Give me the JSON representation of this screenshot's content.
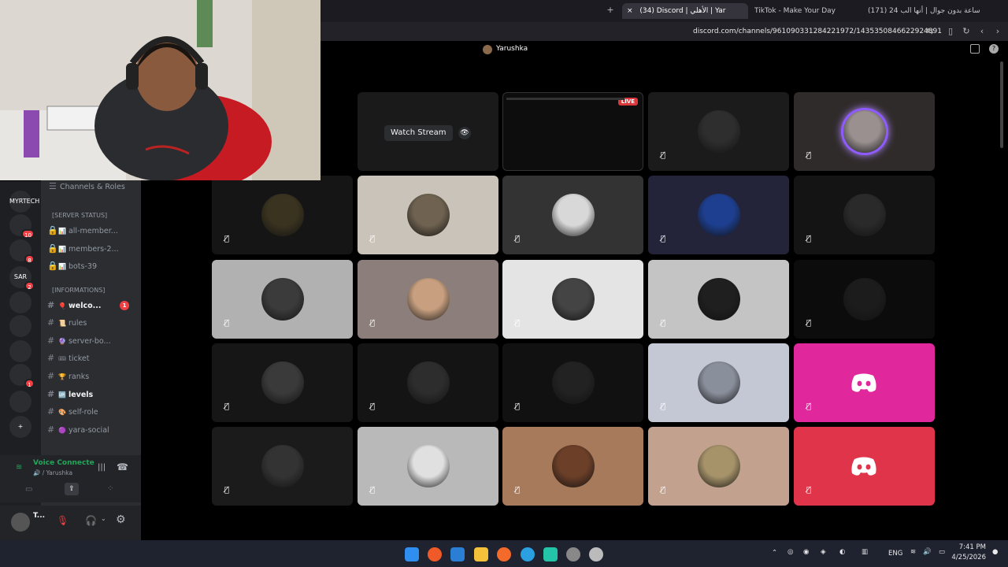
{
  "browser": {
    "tabs": [
      {
        "label": "(34) Discord | الأهلي | Yar",
        "active": true
      },
      {
        "label": "TikTok - Make Your Day",
        "active": false
      },
      {
        "label": "(171) 24 ساعة بدون جوال | أنها الب",
        "active": false
      }
    ],
    "new_tab": "+",
    "close_tab": "×",
    "url": "discord.com/channels/961090331284221972/1435350846622924891"
  },
  "call": {
    "header_user": "Yarushka",
    "watch_stream_label": "Watch Stream",
    "live_badge": "LIVE"
  },
  "servers": [
    {
      "label": "MYRTECH",
      "badge": ""
    },
    {
      "label": "",
      "badge": "10"
    },
    {
      "label": "",
      "badge": "8"
    },
    {
      "label": "SAR",
      "badge": "2"
    },
    {
      "label": "",
      "badge": ""
    },
    {
      "label": "",
      "badge": ""
    },
    {
      "label": "",
      "badge": ""
    },
    {
      "label": "",
      "badge": "1"
    },
    {
      "label": "",
      "badge": ""
    },
    {
      "label": "+",
      "badge": ""
    }
  ],
  "sidebar": {
    "channels_roles": "Channels & Roles",
    "categories": [
      "[SERVER STATUS]",
      "[INFORMATIONS]"
    ],
    "channels": [
      {
        "name": "all-member...",
        "emoji": "📊",
        "locked": true,
        "bold": false,
        "unread": ""
      },
      {
        "name": "members-2...",
        "emoji": "📊",
        "locked": true,
        "bold": false,
        "unread": ""
      },
      {
        "name": "bots-39",
        "emoji": "📊",
        "locked": true,
        "bold": false,
        "unread": ""
      },
      {
        "name": "welco...",
        "emoji": "🎈",
        "locked": false,
        "bold": true,
        "unread": "1"
      },
      {
        "name": "rules",
        "emoji": "📜",
        "locked": false,
        "bold": false,
        "unread": ""
      },
      {
        "name": "server-bo...",
        "emoji": "🔮",
        "locked": false,
        "bold": false,
        "unread": ""
      },
      {
        "name": "ticket",
        "emoji": "🎟",
        "locked": false,
        "bold": false,
        "unread": ""
      },
      {
        "name": "ranks",
        "emoji": "🏆",
        "locked": false,
        "bold": false,
        "unread": ""
      },
      {
        "name": "levels",
        "emoji": "🆙",
        "locked": false,
        "bold": true,
        "unread": ""
      },
      {
        "name": "self-role",
        "emoji": "🎨",
        "locked": false,
        "bold": false,
        "unread": ""
      },
      {
        "name": "yara-social",
        "emoji": "🟣",
        "locked": false,
        "bold": false,
        "unread": ""
      }
    ]
  },
  "voice": {
    "status": "Voice Connecte",
    "channel": "🔊 / Yarushka"
  },
  "user": {
    "name": "T..."
  },
  "tiles": [
    {
      "kind": "stream",
      "bg": "#1a1a1a"
    },
    {
      "kind": "screen",
      "bg": "#0d0d0d"
    },
    {
      "kind": "user",
      "bg": "#1b1b1b",
      "av": "#2e2e2e"
    },
    {
      "kind": "user",
      "bg": "#2f2b2a",
      "av": "#9a9090",
      "speaking": true
    },
    {
      "kind": "user",
      "bg": "#151515",
      "av": "#3a3320"
    },
    {
      "kind": "user",
      "bg": "#c9c3b9",
      "av": "#6f6250"
    },
    {
      "kind": "user",
      "bg": "#333333",
      "av": "#d8d8d8"
    },
    {
      "kind": "user",
      "bg": "#23233a",
      "av": "#1e3f8f"
    },
    {
      "kind": "user",
      "bg": "#141414",
      "av": "#2a2a2a"
    },
    {
      "kind": "user",
      "bg": "#b1b1b1",
      "av": "#3b3b3b"
    },
    {
      "kind": "user",
      "bg": "#8b7e7b",
      "av": "#c8a080"
    },
    {
      "kind": "user",
      "bg": "#e4e4e4",
      "av": "#444444"
    },
    {
      "kind": "user",
      "bg": "#c4c4c4",
      "av": "#1f1f1f"
    },
    {
      "kind": "user",
      "bg": "#0c0c0c",
      "av": "#1c1c1c"
    },
    {
      "kind": "user",
      "bg": "#161616",
      "av": "#3a3a3a"
    },
    {
      "kind": "user",
      "bg": "#141414",
      "av": "#2d2d2d"
    },
    {
      "kind": "user",
      "bg": "#111111",
      "av": "#222222"
    },
    {
      "kind": "user",
      "bg": "#c3c8d4",
      "av": "#8a8f9c"
    },
    {
      "kind": "discord",
      "bg": "#e0289c"
    },
    {
      "kind": "user",
      "bg": "#1b1b1b",
      "av": "#333333"
    },
    {
      "kind": "user",
      "bg": "#b9b9b9",
      "av": "#e0e0e0"
    },
    {
      "kind": "user",
      "bg": "#a87a5c",
      "av": "#6b3f28"
    },
    {
      "kind": "user",
      "bg": "#c2a28f",
      "av": "#a7936a"
    },
    {
      "kind": "discord",
      "bg": "#e0344a"
    }
  ],
  "colors": {
    "accent": "#5865f2",
    "speaking": "#8f5bff",
    "danger": "#f23f43",
    "live": "#da373c"
  },
  "taskbar": {
    "lang": "ENG",
    "time": "7:41 PM",
    "date": "4/25/2026"
  }
}
